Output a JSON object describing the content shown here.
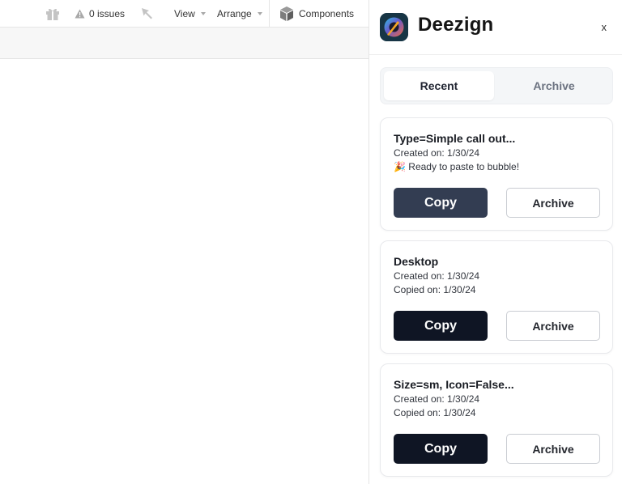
{
  "toolbar": {
    "issues_label": "0 issues",
    "view_label": "View",
    "arrange_label": "Arrange",
    "components_label": "Components"
  },
  "plugin": {
    "name": "Deezign",
    "close_label": "x",
    "tabs": [
      {
        "label": "Recent",
        "active": true
      },
      {
        "label": "Archive",
        "active": false
      }
    ],
    "cards": [
      {
        "title": "Type=Simple call out...",
        "created": "Created on: 1/30/24",
        "status": "🎉 Ready to paste to bubble!",
        "copy_label": "Copy",
        "archive_label": "Archive",
        "copy_color": "#333d52"
      },
      {
        "title": "Desktop",
        "created": "Created on: 1/30/24",
        "status": "Copied on: 1/30/24",
        "copy_label": "Copy",
        "archive_label": "Archive",
        "copy_color": "#0f1524"
      },
      {
        "title": "Size=sm, Icon=False...",
        "created": "Created on: 1/30/24",
        "status": "Copied on: 1/30/24",
        "copy_label": "Copy",
        "archive_label": "Archive",
        "copy_color": "#0f1524"
      }
    ]
  },
  "colors": {
    "primary_dark": "#0f1524",
    "primary_active": "#333d52",
    "tab_bg": "#f4f6f8"
  }
}
